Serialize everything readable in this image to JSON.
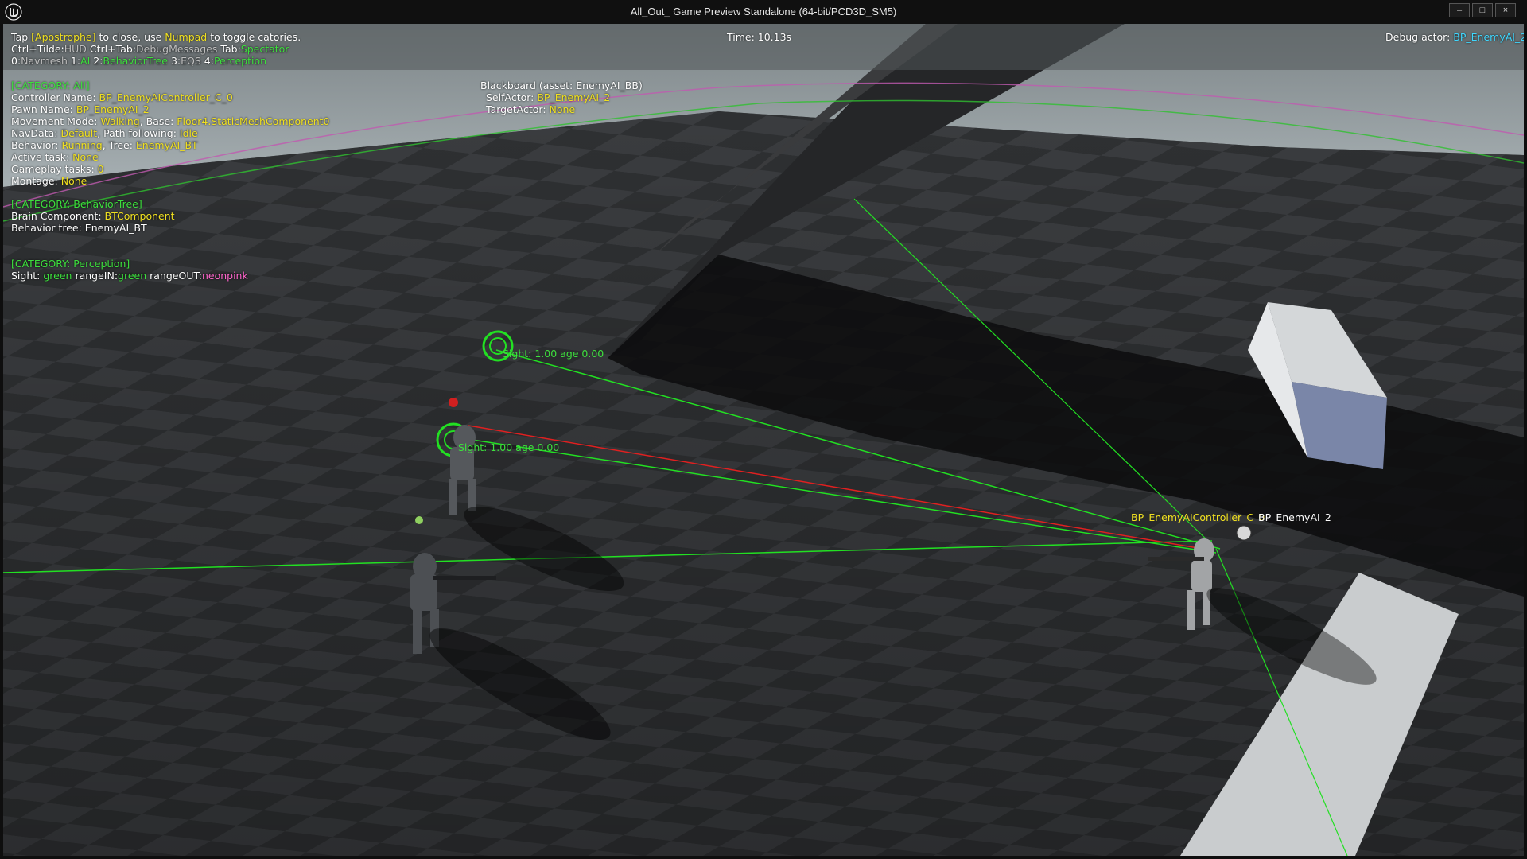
{
  "window": {
    "title": "All_Out_ Game Preview Standalone (64-bit/PCD3D_SM5)",
    "minimize": "–",
    "maximize": "□",
    "close": "×"
  },
  "hud": {
    "line1": {
      "a": "Tap ",
      "b": "[Apostrophe]",
      "c": " to close, use ",
      "d": "Numpad",
      "e": " to toggle catories."
    },
    "line2": {
      "a": "Ctrl+Tilde:",
      "b": "HUD",
      "c": "  Ctrl+Tab:",
      "d": "DebugMessages",
      "e": "  Tab:",
      "f": "Spectator"
    },
    "line3": {
      "a": "0:",
      "b": "Navmesh",
      "c": "  1:",
      "d": "AI",
      "e": "  2:",
      "f": "BehaviorTree",
      "g": "  3:",
      "h": "EQS",
      "i": "  4:",
      "j": "Perception"
    },
    "time": "Time: 10.13s",
    "debug_actor_label": "Debug actor: ",
    "debug_actor_value": "BP_EnemyAI_2"
  },
  "category_all": {
    "header": "[CATEGORY: All]",
    "controller_label": "Controller Name: ",
    "controller_value": "BP_EnemyAIController_C_0",
    "pawn_label": "Pawn Name: ",
    "pawn_value": "BP_EnemyAI_2",
    "movement_label": "Movement Mode: ",
    "movement_value": "Walking",
    "base_label": ", Base: ",
    "base_value": "Floor4.StaticMeshComponent0",
    "navdata_label": "NavData: ",
    "navdata_value": "Default",
    "path_label": ", Path following: ",
    "path_value": "Idle",
    "behavior_label": "Behavior: ",
    "behavior_value": "Running",
    "tree_label": ", Tree: ",
    "tree_value": "EnemyAI_BT",
    "active_task_label": "Active task: ",
    "active_task_value": "None",
    "gameplay_tasks_label": "Gameplay tasks: ",
    "gameplay_tasks_value": "0",
    "montage_label": "Montage: ",
    "montage_value": "None"
  },
  "category_bt": {
    "header": "[CATEGORY: BehaviorTree]",
    "brain_label": "Brain Component: ",
    "brain_value": "BTComponent",
    "tree_line": "Behavior tree: EnemyAI_BT"
  },
  "category_perception": {
    "header": "[CATEGORY: Perception]",
    "sight_label": "Sight: ",
    "sight_value": "green",
    "range_in_label": " rangeIN:",
    "range_in_value": "green",
    "range_out_label": "  rangeOUT:",
    "range_out_value": "neonpink"
  },
  "blackboard": {
    "header": "Blackboard (asset: EnemyAI_BB)",
    "self_label": "SelfActor: ",
    "self_value": "BP_EnemyAI_2",
    "target_label": "TargetActor: ",
    "target_value": "None"
  },
  "world_labels": {
    "sight_1": "Sight: 1.00 age 0.00",
    "sight_2": "Sight: 1.00 age 0.00",
    "controller_tag": "BP_EnemyAIController_C_0",
    "pawn_tag": "BP_EnemyAI_2"
  },
  "colors": {
    "hud_yellow": "#f0e020",
    "hud_green": "#3de03d",
    "hud_cyan": "#40d8ff",
    "hud_pink": "#ff66cc",
    "sight_line": "#22e022",
    "target_line": "#e02020"
  }
}
